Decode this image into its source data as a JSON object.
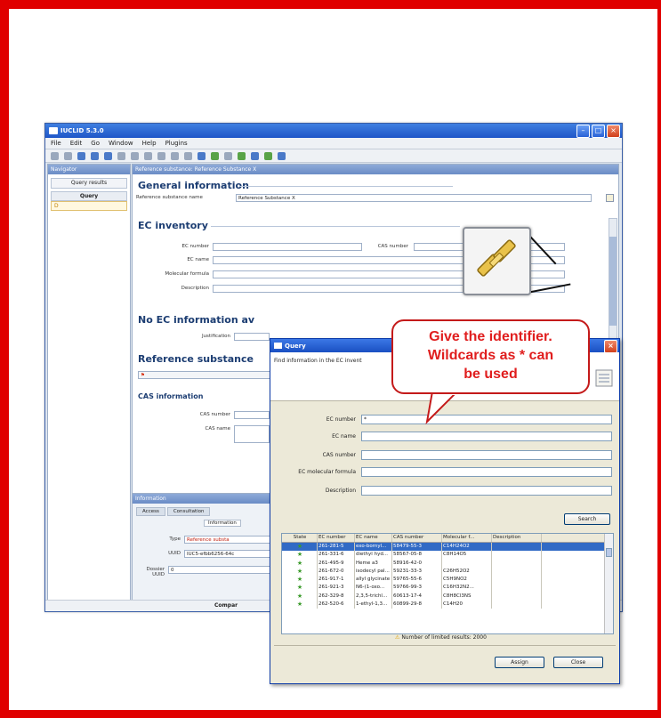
{
  "app": {
    "title": "IUCLID 5.3.0",
    "menu": [
      "File",
      "Edit",
      "Go",
      "Window",
      "Help",
      "Plugins"
    ]
  },
  "navigator": {
    "header": "Navigator",
    "tab": "Query results",
    "column": "Query",
    "row": "D"
  },
  "editor": {
    "header": "Reference substance: Reference Substance X",
    "general_title": "General information",
    "ref_name_label": "Reference substance name",
    "ref_name_value": "Reference Substance X",
    "ec_title": "EC inventory",
    "ec_number_label": "EC number",
    "cas_number_label": "CAS number",
    "ec_name_label": "EC name",
    "mol_formula_label": "Molecular formula",
    "description_label": "Description",
    "no_ec_title": "No EC information av",
    "justification_label": "Justification",
    "ref_sub_title": "Reference substance",
    "cas_info_title": "CAS information",
    "cas_number2_label": "CAS number",
    "cas_name_label": "CAS name"
  },
  "info_panel": {
    "header": "Information",
    "tabs": [
      "Access",
      "Consultation"
    ],
    "subtab": "Information",
    "type_label": "Type",
    "type_value": "Reference substa",
    "uuid_label": "UUID",
    "uuid_value": "IUC5-efbb6256-64c",
    "dossier_label": "Dossier UUID",
    "dossier_value": "0",
    "statusbar": "Compar"
  },
  "query_dialog": {
    "title": "Query",
    "description": "Find information in the EC invent",
    "fields": [
      {
        "label": "EC number",
        "value": "*"
      },
      {
        "label": "EC name",
        "value": ""
      },
      {
        "label": "CAS number",
        "value": ""
      },
      {
        "label": "EC molecular formula",
        "value": ""
      },
      {
        "label": "Description",
        "value": ""
      }
    ],
    "search_button": "Search",
    "columns": [
      "State",
      "EC number",
      "EC name",
      "CAS number",
      "Molecular f...",
      "Description"
    ],
    "rows": [
      {
        "ec": "261-281-5",
        "name": "exo-bornyl...",
        "cas": "58479-55-3",
        "formula": "C14H24O2"
      },
      {
        "ec": "261-331-6",
        "name": "diethyl hyd...",
        "cas": "58567-05-8",
        "formula": "C8H14O5"
      },
      {
        "ec": "261-495-9",
        "name": "Heme a3",
        "cas": "58916-42-0",
        "formula": ""
      },
      {
        "ec": "261-672-0",
        "name": "isodecyl pal...",
        "cas": "59231-33-3",
        "formula": "C26H52O2"
      },
      {
        "ec": "261-917-1",
        "name": "allyl glycinate",
        "cas": "59765-55-6",
        "formula": "C5H9NO2"
      },
      {
        "ec": "261-921-3",
        "name": "N6-(1-oxo...",
        "cas": "59766-99-3",
        "formula": "C16H32N2..."
      },
      {
        "ec": "262-329-8",
        "name": "2,3,5-trichl...",
        "cas": "60613-17-4",
        "formula": "C8H8Cl3NS"
      },
      {
        "ec": "262-520-6",
        "name": "1-ethyl-1,3...",
        "cas": "60899-29-8",
        "formula": "C14H20"
      }
    ],
    "limited_results": "Number of limited results: 2000",
    "assign_button": "Assign",
    "close_button": "Close"
  },
  "callout": {
    "text": "Give the identifier.\nWildcards as * can\nbe used",
    "color": "#e01e1e"
  },
  "border_color": "#e00000"
}
